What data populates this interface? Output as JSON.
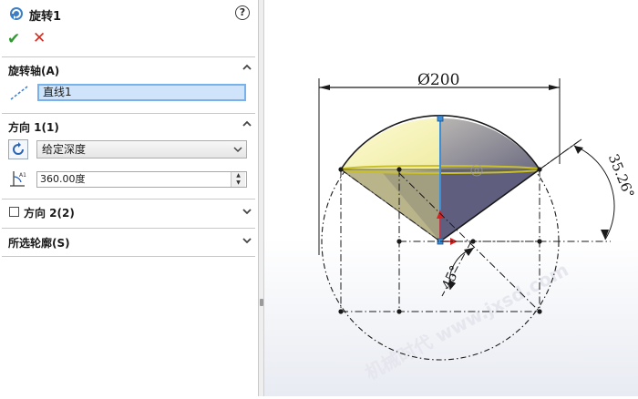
{
  "panel": {
    "title": "旋转1",
    "help_glyph": "?",
    "ok_glyph": "✔",
    "cancel_glyph": "✕",
    "sections": {
      "axis": {
        "title": "旋转轴(A)",
        "field_value": "直线1"
      },
      "direction1": {
        "title": "方向 1(1)",
        "end_condition": "给定深度",
        "angle_value": "360.00度"
      },
      "direction2": {
        "title": "方向 2(2)",
        "checked": false
      },
      "contours": {
        "title": "所选轮廓(S)"
      }
    }
  },
  "viewport": {
    "dimension_diameter": "Ø200",
    "dimension_angle_right": "35.26°",
    "dimension_angle_bottom": "45°",
    "watermark": "机械时代 www.jxsd.com"
  },
  "colors": {
    "accent_selection": "#cfe4fa",
    "ok_green": "#2e9b2e",
    "cancel_red": "#d42a1e",
    "axis_blue": "#3b8fd8",
    "cone_yellow": "#fbf8c0",
    "cone_gray": "#8a8a9a"
  },
  "icons": [
    "revolve-feature-icon",
    "help-icon",
    "ok-check-icon",
    "cancel-x-icon",
    "axis-line-icon",
    "reverse-direction-icon",
    "angle-depth-icon",
    "chevron-up-icon",
    "chevron-down-icon"
  ]
}
